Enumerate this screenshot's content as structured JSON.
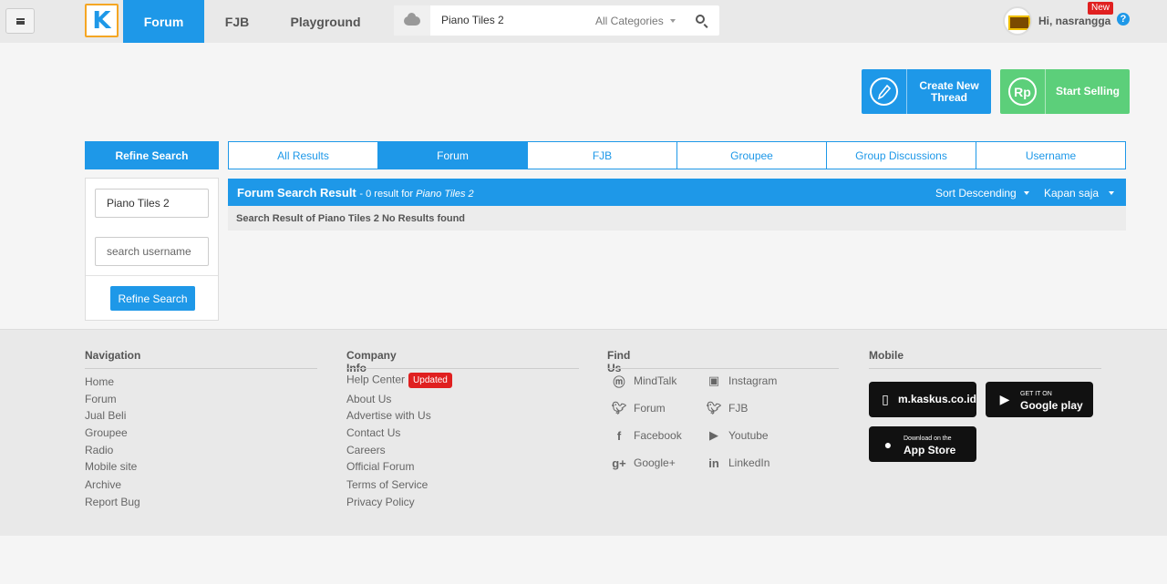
{
  "header": {
    "nav_tabs": [
      {
        "label": "Forum",
        "active": true
      },
      {
        "label": "FJB",
        "active": false
      },
      {
        "label": "Playground",
        "active": false
      }
    ],
    "search": {
      "query": "Piano Tiles 2",
      "category": "All Categories"
    },
    "user": {
      "greeting": "Hi, nasrangga",
      "badge": "New"
    },
    "help": "?"
  },
  "actions": {
    "create_thread": "Create New Thread",
    "start_selling": "Start Selling",
    "rp_icon": "Rp"
  },
  "refine": {
    "title": "Refine Search",
    "keyword_value": "Piano Tiles 2",
    "username_placeholder": "search username",
    "submit_label": "Refine Search"
  },
  "result_tabs": [
    {
      "label": "All Results",
      "active": false
    },
    {
      "label": "Forum",
      "active": true
    },
    {
      "label": "FJB",
      "active": false
    },
    {
      "label": "Groupee",
      "active": false
    },
    {
      "label": "Group Discussions",
      "active": false
    },
    {
      "label": "Username",
      "active": false
    }
  ],
  "results": {
    "title": "Forum Search Result",
    "count_text": "- 0 result for",
    "query": "Piano Tiles 2",
    "sort_label": "Sort Descending",
    "time_label": "Kapan saja",
    "message": "Search Result of Piano Tiles 2 No Results found"
  },
  "footer": {
    "navigation": {
      "title": "Navigation",
      "links": [
        "Home",
        "Forum",
        "Jual Beli",
        "Groupee",
        "Radio",
        "Mobile site",
        "Archive",
        "Report Bug"
      ]
    },
    "company": {
      "title": "Company Info",
      "links": [
        "Help Center",
        "About Us",
        "Advertise with Us",
        "Contact Us",
        "Careers",
        "Official Forum",
        "Terms of Service",
        "Privacy Policy"
      ],
      "updated_badge": "Updated"
    },
    "find_us": {
      "title": "Find Us",
      "items": [
        {
          "label": "MindTalk",
          "icon": "mindtalk-icon"
        },
        {
          "label": "Instagram",
          "icon": "instagram-icon"
        },
        {
          "label": "Forum",
          "icon": "twitter-icon"
        },
        {
          "label": "FJB",
          "icon": "twitter-icon"
        },
        {
          "label": "Facebook",
          "icon": "facebook-icon"
        },
        {
          "label": "Youtube",
          "icon": "youtube-icon"
        },
        {
          "label": "Google+",
          "icon": "google-plus-icon"
        },
        {
          "label": "LinkedIn",
          "icon": "linkedin-icon"
        }
      ]
    },
    "mobile": {
      "title": "Mobile",
      "mkaskus": "m.kaskus.co.id",
      "google_play_small": "GET IT ON",
      "google_play": "Google play",
      "app_store_small": "Download on the",
      "app_store": "App Store"
    }
  }
}
